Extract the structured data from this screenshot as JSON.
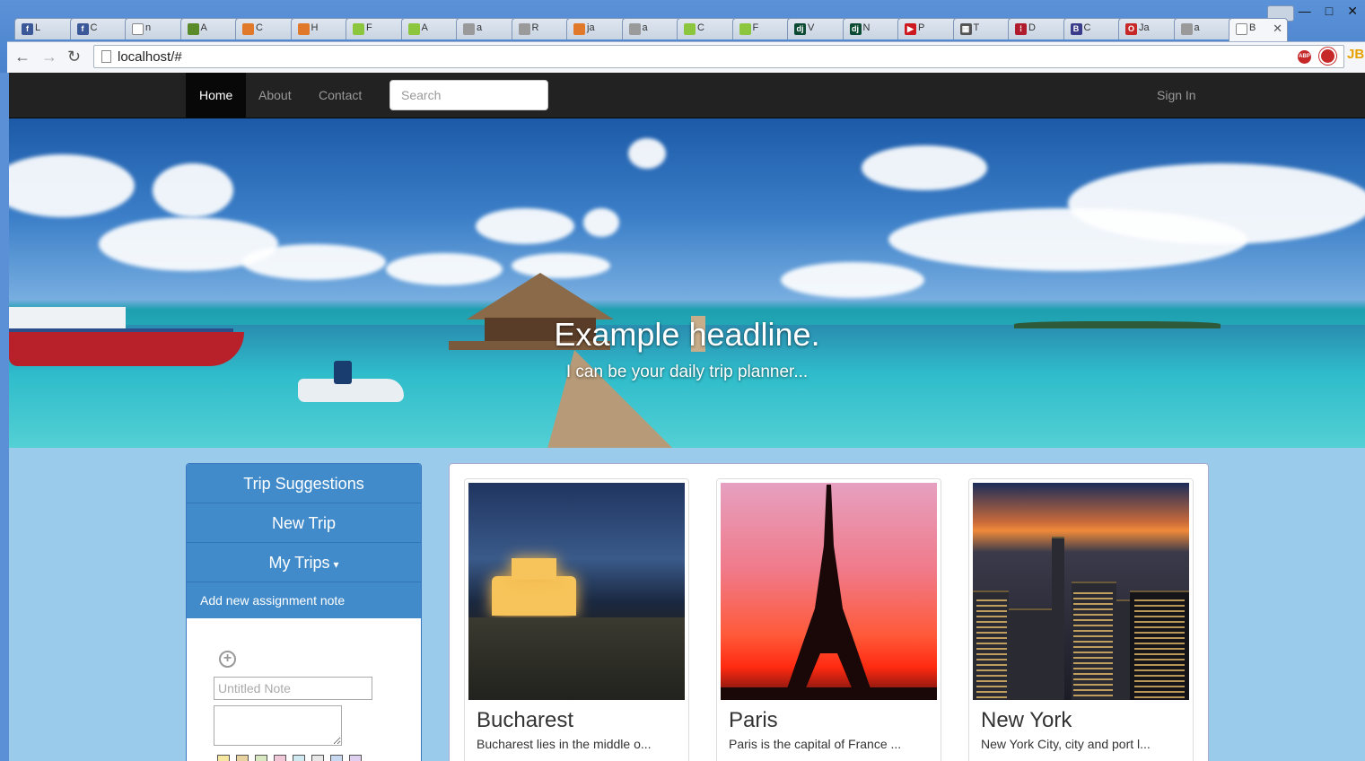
{
  "browser": {
    "tabs": [
      {
        "icon": "facebook-icon",
        "label": "L",
        "color": "#3b5998",
        "glyph": "f"
      },
      {
        "icon": "facebook-icon",
        "label": "C",
        "color": "#3b5998",
        "glyph": "f"
      },
      {
        "icon": "page-icon",
        "label": "n",
        "color": "#ffffff",
        "glyph": ""
      },
      {
        "icon": "leaf-icon",
        "label": "A",
        "color": "#5a8a2a",
        "glyph": ""
      },
      {
        "icon": "stackoverflow-icon",
        "label": "C",
        "color": "#e07a2a",
        "glyph": ""
      },
      {
        "icon": "stackoverflow-icon",
        "label": "H",
        "color": "#e07a2a",
        "glyph": ""
      },
      {
        "icon": "android-icon",
        "label": "F",
        "color": "#8cc63f",
        "glyph": ""
      },
      {
        "icon": "android-icon",
        "label": "A",
        "color": "#8cc63f",
        "glyph": ""
      },
      {
        "icon": "stackoverflow-icon",
        "label": "a",
        "color": "#9a9a9a",
        "glyph": ""
      },
      {
        "icon": "stackoverflow-icon",
        "label": "R",
        "color": "#9a9a9a",
        "glyph": ""
      },
      {
        "icon": "stackoverflow-icon",
        "label": "ja",
        "color": "#e07a2a",
        "glyph": ""
      },
      {
        "icon": "stackoverflow-icon",
        "label": "a",
        "color": "#9a9a9a",
        "glyph": ""
      },
      {
        "icon": "android-icon",
        "label": "C",
        "color": "#8cc63f",
        "glyph": ""
      },
      {
        "icon": "android-icon",
        "label": "F",
        "color": "#8cc63f",
        "glyph": ""
      },
      {
        "icon": "django-icon",
        "label": "V",
        "color": "#0c4b33",
        "glyph": "dj"
      },
      {
        "icon": "django-icon",
        "label": "N",
        "color": "#0c4b33",
        "glyph": "dj"
      },
      {
        "icon": "youtube-icon",
        "label": "P",
        "color": "#cc181e",
        "glyph": "▶"
      },
      {
        "icon": "table-icon",
        "label": "T",
        "color": "#555555",
        "glyph": "▦"
      },
      {
        "icon": "dots-icon",
        "label": "D",
        "color": "#b01c2e",
        "glyph": "⁞"
      },
      {
        "icon": "bootstrap-icon",
        "label": "C",
        "color": "#3a3a8a",
        "glyph": "B"
      },
      {
        "icon": "oracle-icon",
        "label": "Ja",
        "color": "#c62828",
        "glyph": "O"
      },
      {
        "icon": "stackoverflow-icon",
        "label": "a",
        "color": "#9a9a9a",
        "glyph": ""
      },
      {
        "icon": "page-icon",
        "label": "B",
        "color": "#ffffff",
        "glyph": "",
        "active": true
      }
    ],
    "url": "localhost/#",
    "window_controls": [
      "—",
      "□",
      "✕"
    ]
  },
  "navbar": {
    "links": [
      "Home",
      "About",
      "Contact"
    ],
    "search_placeholder": "Search",
    "signin": "Sign In"
  },
  "hero": {
    "headline": "Example headline.",
    "tagline": "I can be your daily trip planner..."
  },
  "sidebar": {
    "items": [
      "Trip Suggestions",
      "New Trip",
      "My Trips"
    ],
    "assignment_header": "Add new assignment note",
    "note_title_placeholder": "Untitled Note",
    "swatch_colors": [
      "#f5e6a0",
      "#e8d2a0",
      "#d8e8c0",
      "#f2c8d8",
      "#d0e8f0",
      "#e8e8e8",
      "#c8d8f0",
      "#e0d0f0"
    ]
  },
  "cards": [
    {
      "city": "Bucharest",
      "desc": "Bucharest lies in the middle o..."
    },
    {
      "city": "Paris",
      "desc": "Paris is the capital of France ..."
    },
    {
      "city": "New York",
      "desc": "New York City, city and port l..."
    }
  ]
}
